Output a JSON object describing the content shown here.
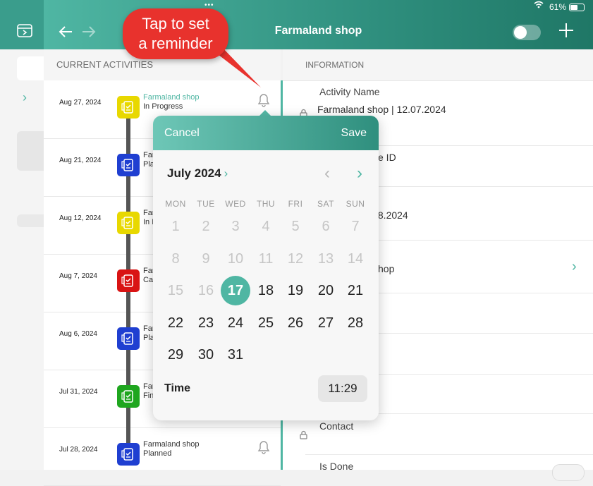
{
  "status_bar": {
    "battery": "61%"
  },
  "header": {
    "title": "Farmaland shop",
    "back_icon": "arrow-left-icon",
    "forward_icon": "arrow-right-icon",
    "add_icon": "plus-icon"
  },
  "left_column": {
    "heading": "CURRENT ACTIVITIES"
  },
  "right_column": {
    "heading": "INFORMATION"
  },
  "activities": [
    {
      "date": "Aug 27, 2024",
      "name": "Farmaland shop",
      "status": "In Progress",
      "color": "#e8d800"
    },
    {
      "date": "Aug 21, 2024",
      "name": "Farı",
      "status": "Pla",
      "color": "#1f3fd1"
    },
    {
      "date": "Aug 12, 2024",
      "name": "Farı",
      "status": "In I",
      "color": "#e8d800"
    },
    {
      "date": "Aug 7, 2024",
      "name": "Farı",
      "status": "Ca",
      "color": "#d91414"
    },
    {
      "date": "Aug 6, 2024",
      "name": "Farı",
      "status": "Pla",
      "color": "#1f3fd1"
    },
    {
      "date": "Jul 31, 2024",
      "name": "Farı",
      "status": "Fin",
      "color": "#1fa61f"
    },
    {
      "date": "Jul 28, 2024",
      "name": "Farmaland shop",
      "status": "Planned",
      "color": "#1f3fd1"
    }
  ],
  "info": {
    "activity_name_label": "Activity Name",
    "activity_name_value": "Farmaland shop | 12.07.2024",
    "id_label_fragment": "e ID",
    "date_fragment": ".8.2024",
    "shop_fragment": "hop",
    "contact_label": "Contact",
    "is_done_label": "Is Done"
  },
  "callout": {
    "line1": "Tap to set",
    "line2": "a reminder"
  },
  "popup": {
    "cancel": "Cancel",
    "save": "Save",
    "month": "July 2024",
    "weekdays": [
      "MON",
      "TUE",
      "WED",
      "THU",
      "FRI",
      "SAT",
      "SUN"
    ],
    "weeks": [
      [
        "1",
        "2",
        "3",
        "4",
        "5",
        "6",
        "7"
      ],
      [
        "8",
        "9",
        "10",
        "11",
        "12",
        "13",
        "14"
      ],
      [
        "15",
        "16",
        "17",
        "18",
        "19",
        "20",
        "21"
      ],
      [
        "22",
        "23",
        "24",
        "25",
        "26",
        "27",
        "28"
      ],
      [
        "29",
        "30",
        "31"
      ]
    ],
    "selected_day": "17",
    "time_label": "Time",
    "time_value": "11:29"
  }
}
